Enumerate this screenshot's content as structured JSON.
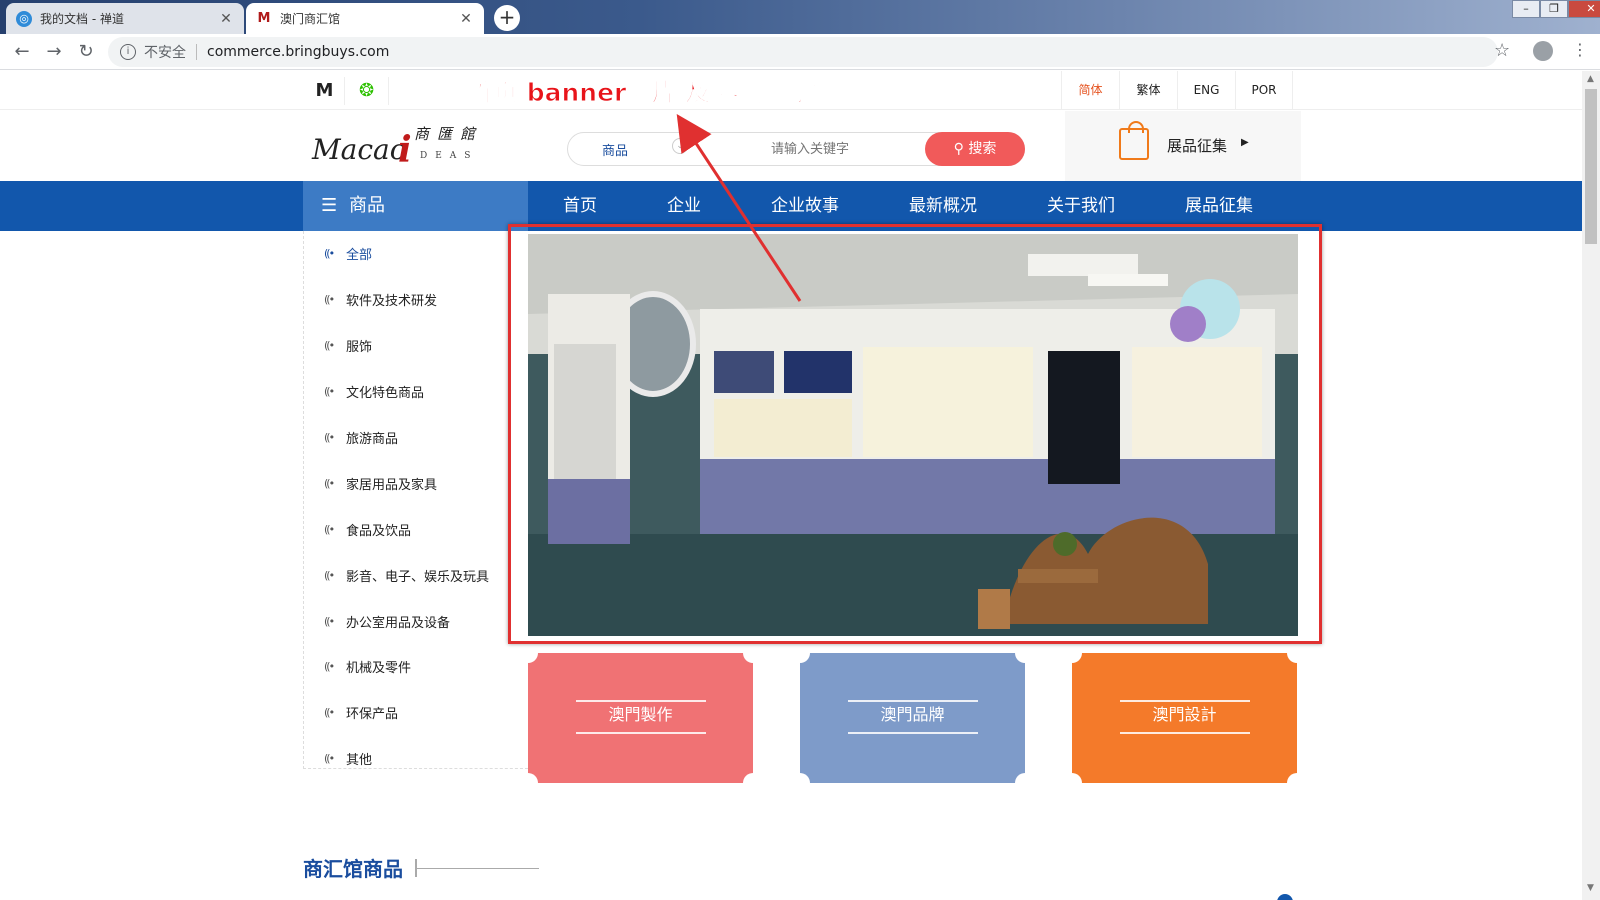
{
  "browser": {
    "tabs": [
      {
        "title": "我的文档 - 禅道",
        "active": false
      },
      {
        "title": "澳门商汇馆",
        "active": true
      }
    ],
    "new_tab": "+",
    "security_label": "不安全",
    "url": "commerce.bringbuys.com",
    "window_controls": [
      "–",
      "❐",
      "✕"
    ]
  },
  "site": {
    "languages": [
      "简体",
      "繁体",
      "ENG",
      "POR"
    ],
    "active_language": "简体",
    "logo": {
      "latin": "Macao",
      "i": "i",
      "cn": "商匯館",
      "sub": "DEAS"
    },
    "search": {
      "category": "商品",
      "placeholder": "请输入关键字",
      "button": "搜索"
    },
    "collect_label": "展品征集",
    "nav": {
      "category_head": "商品",
      "links": [
        "首页",
        "企业",
        "企业故事",
        "最新概况",
        "关于我们",
        "展品征集"
      ]
    },
    "categories": [
      "全部",
      "软件及技术研发",
      "服饰",
      "文化特色商品",
      "旅游商品",
      "家居用品及家具",
      "食品及饮品",
      "影音、电子、娱乐及玩具",
      "办公室用品及设备",
      "机械及零件",
      "环保产品",
      "其他"
    ],
    "annotation": "首页 banner图片 及 视频 配置",
    "feature_cards": [
      {
        "label": "澳門製作",
        "color": "#f07274"
      },
      {
        "label": "澳門品牌",
        "color": "#7e9bc9"
      },
      {
        "label": "澳門設計",
        "color": "#f47a2a"
      }
    ],
    "section_title": "商汇馆商品"
  },
  "colors": {
    "nav_blue": "#1257ac",
    "accent_red": "#e8141a",
    "search_red": "#f15a5a"
  }
}
